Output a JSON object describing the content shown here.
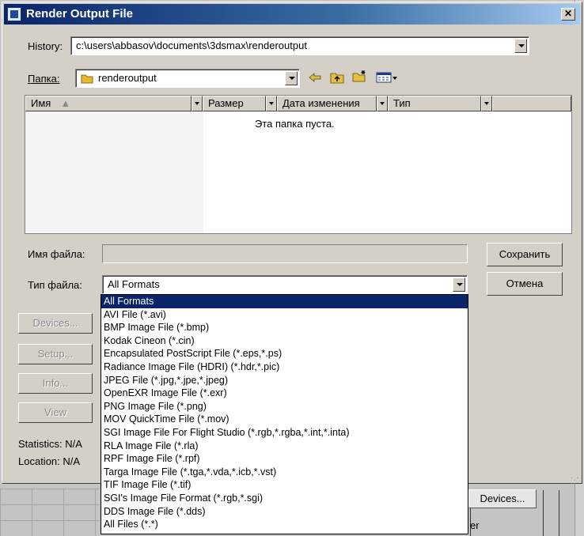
{
  "window": {
    "title": "Render Output File"
  },
  "history": {
    "label": "History:",
    "value": "c:\\users\\abbasov\\documents\\3dsmax\\renderoutput"
  },
  "folder": {
    "label": "Папка:",
    "value": "renderoutput"
  },
  "toolbar": {
    "icons": [
      "back-arrow-icon",
      "up-folder-icon",
      "new-folder-icon",
      "view-menu-icon"
    ]
  },
  "file_list": {
    "columns": [
      "Имя",
      "Размер",
      "Дата изменения",
      "Тип"
    ],
    "empty_text": "Эта папка пуста."
  },
  "filename": {
    "label": "Имя файла:",
    "value": ""
  },
  "filetype": {
    "label": "Тип файла:",
    "value": "All Formats",
    "options": [
      "All Formats",
      "AVI File (*.avi)",
      "BMP Image File (*.bmp)",
      "Kodak Cineon (*.cin)",
      "Encapsulated PostScript File (*.eps,*.ps)",
      "Radiance Image File (HDRI) (*.hdr,*.pic)",
      "JPEG File (*.jpg,*.jpe,*.jpeg)",
      "OpenEXR Image File (*.exr)",
      "PNG Image File (*.png)",
      "MOV QuickTime File (*.mov)",
      "SGI Image File For Flight Studio (*.rgb,*.rgba,*.int,*.inta)",
      "RLA Image File (*.rla)",
      "RPF Image File (*.rpf)",
      "Targa Image File (*.tga,*.vda,*.icb,*.vst)",
      "TIF Image File (*.tif)",
      "SGI's Image File Format (*.rgb,*.sgi)",
      "DDS Image File (*.dds)",
      "All Files (*.*)"
    ],
    "selected_index": 0
  },
  "buttons": {
    "save": "Сохранить",
    "cancel": "Отмена"
  },
  "side_buttons": {
    "devices": "Devices...",
    "setup": "Setup...",
    "info": "Info...",
    "view": "View"
  },
  "status": {
    "statistics": "Statistics:  N/A",
    "location": "Location:  N/A"
  },
  "background": {
    "devices": "Devices...",
    "fragment": "er"
  },
  "colors": {
    "title_bar": "#0a246a",
    "selection": "#0a246a",
    "dialog": "#d4d0c8"
  }
}
